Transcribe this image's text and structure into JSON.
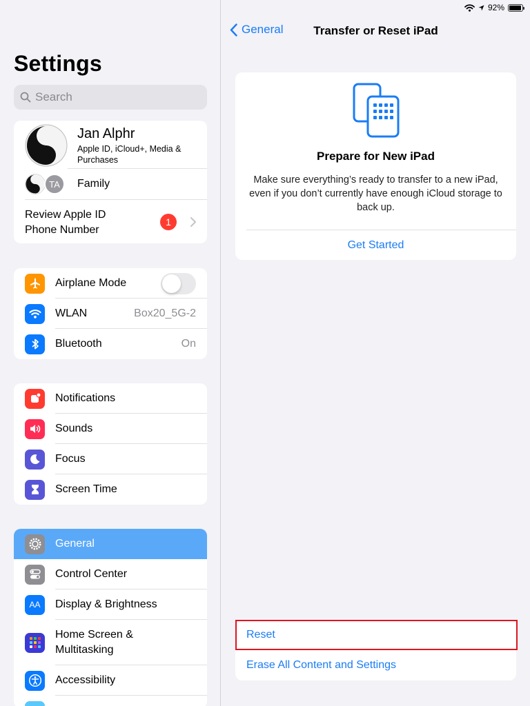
{
  "status_bar": {
    "battery_percent": "92%",
    "battery_level": 0.92
  },
  "sidebar": {
    "title": "Settings",
    "search_placeholder": "Search",
    "profile": {
      "name": "Jan Alphr",
      "subtitle": "Apple ID, iCloud+, Media & Purchases",
      "family_initials": "TA",
      "family_label": "Family",
      "review_label_line1": "Review Apple ID",
      "review_label_line2": "Phone Number",
      "review_badge": "1"
    },
    "connectivity": [
      {
        "label": "Airplane Mode",
        "icon": "airplane-icon",
        "color": "#ff9500",
        "toggle": false
      },
      {
        "label": "WLAN",
        "icon": "wifi-icon",
        "color": "#0a7aff",
        "value": "Box20_5G-2"
      },
      {
        "label": "Bluetooth",
        "icon": "bluetooth-icon",
        "color": "#0a7aff",
        "value": "On"
      }
    ],
    "notifications_group": [
      {
        "label": "Notifications",
        "icon": "bell-icon",
        "color": "#ff3b30"
      },
      {
        "label": "Sounds",
        "icon": "speaker-icon",
        "color": "#ff2d55"
      },
      {
        "label": "Focus",
        "icon": "moon-icon",
        "color": "#5856d6"
      },
      {
        "label": "Screen Time",
        "icon": "hourglass-icon",
        "color": "#5856d6"
      }
    ],
    "general_group": [
      {
        "label": "General",
        "icon": "gear-icon",
        "color": "#8e8e93",
        "selected": true
      },
      {
        "label": "Control Center",
        "icon": "switches-icon",
        "color": "#8e8e93"
      },
      {
        "label": "Display & Brightness",
        "icon": "text-size-icon",
        "color": "#0a7aff",
        "glyph": "AA"
      },
      {
        "label_line1": "Home Screen &",
        "label_line2": "Multitasking",
        "icon": "app-grid-icon",
        "color": "#3a3ad6"
      },
      {
        "label": "Accessibility",
        "icon": "accessibility-icon",
        "color": "#0a7aff"
      }
    ]
  },
  "detail": {
    "back_label": "General",
    "title": "Transfer or Reset iPad",
    "prepare_card": {
      "icon": "ipad-transfer-icon",
      "title": "Prepare for New iPad",
      "body": "Make sure everything’s ready to transfer to a new iPad, even if you don’t currently have enough iCloud storage to back up.",
      "action": "Get Started"
    },
    "reset_label": "Reset",
    "erase_label": "Erase All Content and Settings",
    "accent_color": "#1a7cf5",
    "highlight_color": "#e0141e"
  }
}
